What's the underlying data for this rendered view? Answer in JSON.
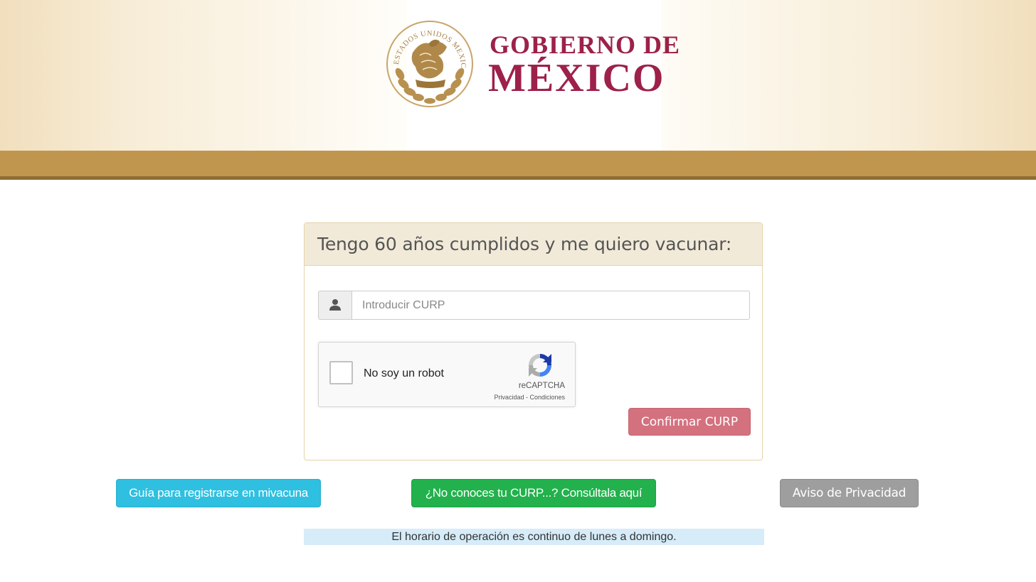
{
  "header": {
    "brand_line1": "GOBIERNO DE",
    "brand_line2": "MÉXICO",
    "seal_icon": "mexico-coat-of-arms-seal",
    "seal_ring_text": "ESTADOS UNIDOS MEXICANOS",
    "brand_color": "#9d2148",
    "gold_bar_color": "#c0964f"
  },
  "panel": {
    "title": "Tengo 60 años cumplidos y me quiero vacunar:",
    "curp_input": {
      "placeholder": "Introducir CURP",
      "value": "",
      "icon": "user-icon"
    },
    "recaptcha": {
      "label": "No soy un robot",
      "brand": "reCAPTCHA",
      "privacy_link": "Privacidad",
      "separator": " - ",
      "terms_link": "Condiciones",
      "checked": false,
      "icon": "recaptcha-logo-icon"
    },
    "confirm_button": "Confirmar CURP",
    "confirm_color": "#d4717f"
  },
  "actions": {
    "guide_button": "Guía para registrarse en mivacuna",
    "curp_lookup_button": "¿No conoces tu CURP...? Consúltala aquí",
    "privacy_button": "Aviso de Privacidad"
  },
  "notice": "El horario de operación es continuo de lunes a domingo."
}
